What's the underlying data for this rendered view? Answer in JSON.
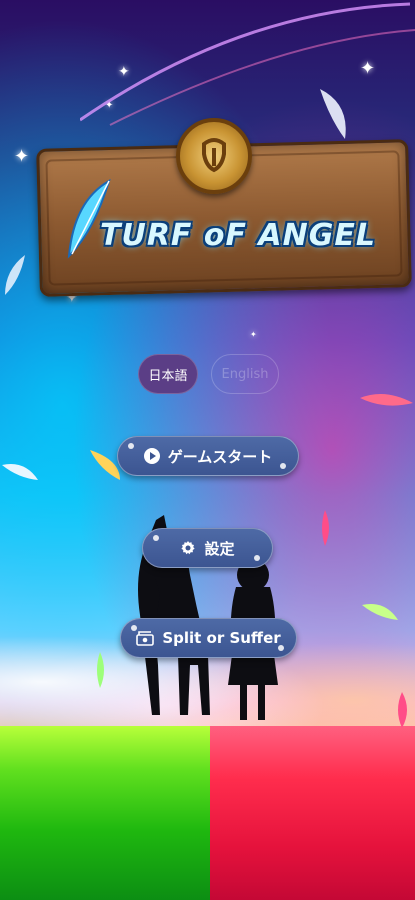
{
  "game_title": "TURF oF ANGEL",
  "language": {
    "japanese_label": "日本語",
    "english_label": "English",
    "selected": "japanese"
  },
  "menu": {
    "start_label": "ゲームスタート",
    "start_icon": "play-icon",
    "settings_label": "設定",
    "settings_icon": "gear-icon",
    "split_label": "Split or Suffer",
    "split_icon": "cash-icon"
  },
  "colors": {
    "button_bg": "#4e6aa6",
    "language_selected_bg": "#5b3e86",
    "grass_left": "#1fb80f",
    "grass_right": "#e5123c"
  }
}
